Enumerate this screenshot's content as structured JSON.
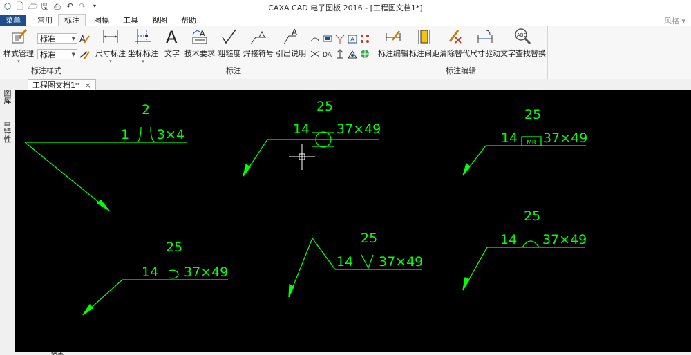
{
  "window": {
    "title": "CAXA CAD 电子图板 2016 - [工程图文档1*]",
    "style_label": "风格"
  },
  "menu_tabs": [
    "菜单",
    "常用",
    "标注",
    "图幅",
    "工具",
    "视图",
    "帮助"
  ],
  "active_tab": "标注",
  "ribbon": {
    "style_group": {
      "label": "标注样式",
      "style_manage_label": "样式管理",
      "text_style_value": "标准",
      "dim_style_value": "标准"
    },
    "annotation_group": {
      "label": "标注",
      "buttons": [
        "尺寸标注",
        "坐标标注",
        "文字",
        "技术要求",
        "粗糙度",
        "焊接符号",
        "引出说明"
      ]
    },
    "edit_group": {
      "label": "标注编辑",
      "buttons": [
        "标注编辑",
        "标注间距",
        "清除替代",
        "尺寸驱动",
        "文字查找替换"
      ]
    }
  },
  "document_tab": {
    "name": "工程图文档1*",
    "close": "×"
  },
  "side_panels": [
    "图库",
    "特性"
  ],
  "bottom_tab": "模型",
  "drawing": {
    "color": "#00ff00",
    "weld_symbols": [
      {
        "above": "2",
        "left": "1",
        "right": "3×4"
      },
      {
        "above": "25",
        "left": "14",
        "right": "37×49"
      },
      {
        "above": "25",
        "left": "14",
        "right": "37×49",
        "box": "MR"
      },
      {
        "above": "25",
        "left": "14",
        "right": "37×49"
      },
      {
        "above": "25",
        "left": "14",
        "right": "37×49"
      },
      {
        "above": "25",
        "left": "14",
        "right": "37×49"
      }
    ]
  }
}
